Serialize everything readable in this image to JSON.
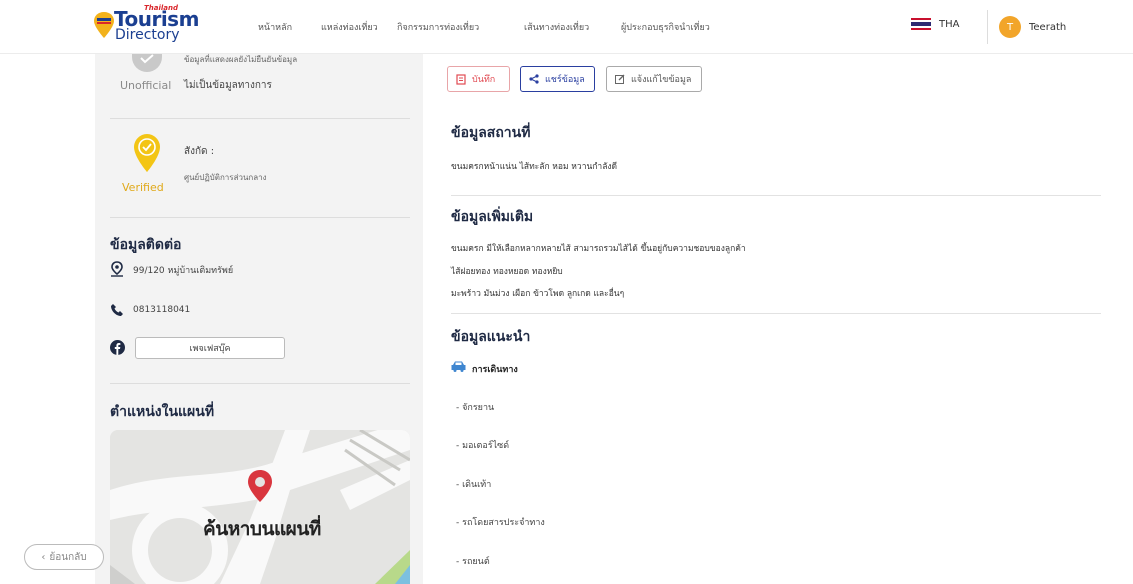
{
  "header": {
    "logo": {
      "top": "Thailand",
      "name": "Tourism",
      "sub": "Directory"
    },
    "nav": [
      "หน้าหลัก",
      "แหล่งท่องเที่ยว",
      "กิจกรรมการท่องเที่ยว",
      "เส้นทางท่องเที่ยว",
      "ผู้ประกอบธุรกิจนำเที่ยว"
    ],
    "lang": "THA",
    "user": {
      "initial": "T",
      "name": "Teerath"
    }
  },
  "sidebar": {
    "cut_text": "ข้อมูลที่แสดงผลยังไม่ยืนยันข้อมูล",
    "unofficial_label": "Unofficial",
    "unofficial_text": "ไม่เป็นข้อมูลทางการ",
    "verified_label": "Verified",
    "affiliation_label": "สังกัด :",
    "affiliation_value": "ศูนย์ปฏิบัติการส่วนกลาง",
    "contact_title": "ข้อมูลติดต่อ",
    "address": "99/120 หมู่บ้านเติมทรัพย์",
    "phone": "0813118041",
    "facebook_btn": "เพจเฟสบุ๊ค",
    "map_title": "ตำแหน่งในแผนที่",
    "map_button": "ค้นหาบนแผนที่"
  },
  "back_button": "ย้อนกลับ",
  "actions": {
    "save": "บันทึก",
    "share": "แชร์ข้อมูล",
    "report": "แจ้งแก้ไขข้อมูล"
  },
  "main": {
    "place_title": "ข้อมูลสถานที่",
    "place_text": "ขนมครกหน้าแน่น ไส้ทะลัก หอม หวานกำลังดี",
    "extra_title": "ข้อมูลเพิ่มเติม",
    "extra_lines": [
      "ขนมครก มีให้เลือกหลากหลายไส้ สามารถรวมไส้ได้ ขึ้นอยู่กับความชอบของลูกค้า",
      "ไส้ฝอยทอง ทองหยอด ทองหยิบ",
      "มะพร้าว มันม่วง เผือก ข้าวโพด ลูกเกด และอื่นๆ"
    ],
    "recommend_title": "ข้อมูลแนะนำ",
    "travel_label": "การเดินทาง",
    "travel_items": [
      "- จักรยาน",
      "- มอเตอร์ไซด์",
      "- เดินเท้า",
      "- รถโดยสารประจำทาง",
      "- รถยนต์"
    ]
  }
}
